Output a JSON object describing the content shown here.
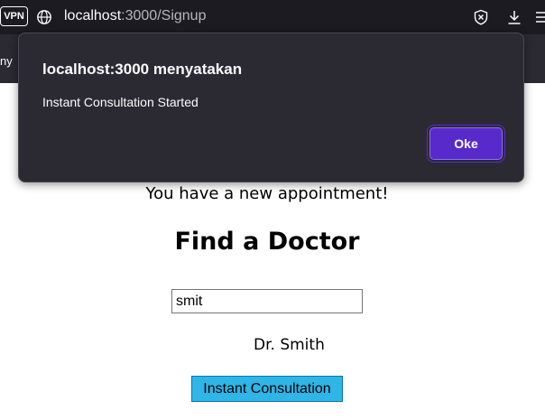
{
  "browser": {
    "vpn_badge": "VPN",
    "url_host": "localhost",
    "url_path": ":3000/Signup",
    "icons": [
      "globe-icon",
      "shield-icon",
      "download-icon",
      "menu-icon"
    ]
  },
  "bookmarks": {
    "fragment": "ny"
  },
  "page": {
    "appointment_message": "You have a new appointment!",
    "title": "Find a Doctor",
    "search_value": "smit",
    "doctor_name": "Dr. Smith",
    "consult_button": "Instant Consultation",
    "consult_button_color": "#2fb5e6"
  },
  "dialog": {
    "title": "localhost:3000 menyatakan",
    "message": "Instant Consultation Started",
    "ok_label": "Oke",
    "ok_color": "#592acb",
    "background": "#2b2a33"
  }
}
